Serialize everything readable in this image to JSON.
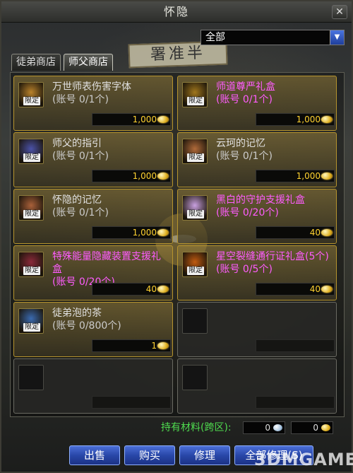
{
  "window": {
    "title": "怀隐",
    "close_symbol": "✕"
  },
  "filter": {
    "selected": "全部"
  },
  "tabs": [
    {
      "label": "徒弟商店",
      "active": false
    },
    {
      "label": "师父商店",
      "active": true
    }
  ],
  "background": {
    "sign_text": "署准半"
  },
  "items": [
    {
      "name": "万世师表伤害字体",
      "account": "(账号 0/1个)",
      "price": "1,000",
      "tag": "限定",
      "color": "white",
      "icon_color": "#b9822b",
      "icon": "scroll-icon"
    },
    {
      "name": "师道尊严礼盒",
      "account": "(账号 0/1个)",
      "price": "1,000",
      "tag": "限定",
      "color": "purple",
      "icon_color": "#a0761c",
      "icon": "gift-box-icon"
    },
    {
      "name": "师父的指引",
      "account": "(账号 0/1个)",
      "price": "1,000",
      "tag": "限定",
      "color": "white",
      "icon_color": "#4b52a8",
      "icon": "book-icon"
    },
    {
      "name": "云珂的记忆",
      "account": "(账号 0/1个)",
      "price": "1,000",
      "tag": "限定",
      "color": "white",
      "icon_color": "#b06a3a",
      "icon": "chest-icon"
    },
    {
      "name": "怀隐的记忆",
      "account": "(账号 0/1个)",
      "price": "1,000",
      "tag": "限定",
      "color": "white",
      "icon_color": "#a9603a",
      "icon": "chest-icon"
    },
    {
      "name": "黑白的守护支援礼盒",
      "account": "(账号 0/20个)",
      "price": "40",
      "tag": "限定",
      "color": "purple",
      "icon_color": "#c9a0e0",
      "icon": "crystal-box-icon"
    },
    {
      "name": "特殊能量隐藏装置支援礼盒",
      "account": "(账号 0/20个)",
      "price": "40",
      "tag": "限定",
      "color": "purple",
      "icon_color": "#8a2a3a",
      "icon": "device-box-icon"
    },
    {
      "name": "星空裂缝通行证礼盒(5个)",
      "account": "(账号 0/5个)",
      "price": "40",
      "tag": "限定",
      "color": "purple",
      "icon_color": "#c05a10",
      "icon": "pass-box-icon"
    },
    {
      "name": "徒弟泡的茶",
      "account": "(账号 0/800个)",
      "price": "1",
      "tag": "限定",
      "color": "white",
      "icon_color": "#3a6ab0",
      "icon": "tea-cup-icon"
    }
  ],
  "materials": {
    "label": "持有材料(跨区):",
    "value1": "0",
    "value2": "0"
  },
  "buttons": {
    "sell": "出售",
    "buy": "购买",
    "repair": "修理",
    "repair_all": "全部修理(S)"
  },
  "watermark": "3DMGAME"
}
